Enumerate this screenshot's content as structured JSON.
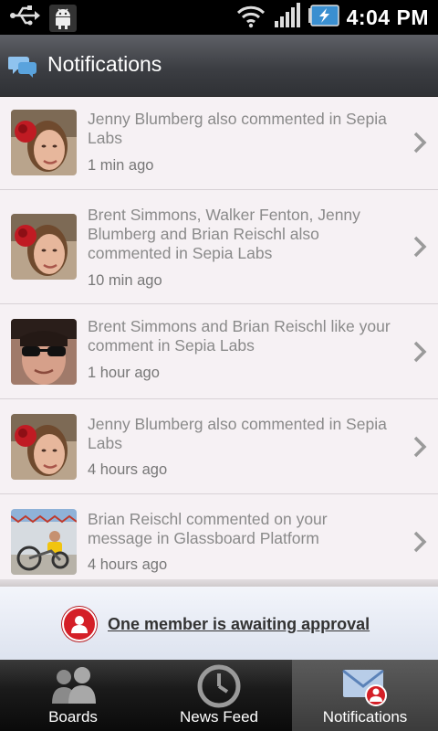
{
  "status_bar": {
    "time": "4:04 PM",
    "icons": [
      "usb-icon",
      "android-debug-icon",
      "wifi-icon",
      "signal-icon",
      "battery-charging-icon"
    ]
  },
  "header": {
    "title": "Notifications",
    "icon": "speech-bubbles-icon"
  },
  "notifications": [
    {
      "text": "Jenny Blumberg also commented in Sepia Labs",
      "time": "1 min ago",
      "avatar": "jenny"
    },
    {
      "text": "Brent Simmons, Walker Fenton, Jenny Blumberg and Brian Reischl also commented in Sepia Labs",
      "time": "10 min ago",
      "avatar": "jenny"
    },
    {
      "text": "Brent Simmons and Brian Reischl like your comment in Sepia Labs",
      "time": "1 hour ago",
      "avatar": "sunglasses"
    },
    {
      "text": "Jenny Blumberg also commented in Sepia Labs",
      "time": "4 hours ago",
      "avatar": "jenny"
    },
    {
      "text": "Brian Reischl commented on your message in Glassboard Platform",
      "time": "4 hours ago",
      "avatar": "bike"
    }
  ],
  "banner": {
    "label": "One member is awaiting approval",
    "icon": "member-alert-icon"
  },
  "tabs": [
    {
      "label": "Boards",
      "icon": "people-icon",
      "active": false
    },
    {
      "label": "News Feed",
      "icon": "clock-icon",
      "active": false
    },
    {
      "label": "Notifications",
      "icon": "envelope-icon",
      "active": true
    }
  ],
  "colors": {
    "accent_red": "#d41f27",
    "list_background": "#f6f1f4",
    "text_gray": "#8a8a8a"
  }
}
